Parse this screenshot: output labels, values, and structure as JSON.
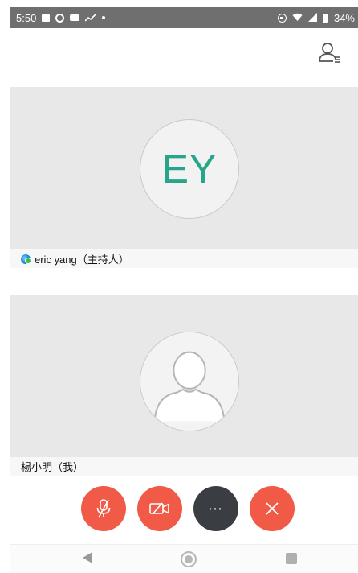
{
  "status_bar": {
    "time": "5:50",
    "battery": "34%",
    "left_icons": [
      "image-icon",
      "app-icon",
      "youtube-icon",
      "graph-icon",
      "dot-icon"
    ],
    "right_icons": [
      "dnd-icon",
      "wifi-icon",
      "signal-icon",
      "battery-icon"
    ]
  },
  "header": {
    "participants_icon": "participants-icon"
  },
  "participants": [
    {
      "initials": "EY",
      "name": "eric yang（主持人）",
      "is_host": true
    },
    {
      "initials": "",
      "name": "楊小明（我）",
      "is_host": false
    }
  ],
  "controls": {
    "mute": "mic-off-icon",
    "video": "video-off-icon",
    "more": "⋯",
    "leave": "close-icon"
  },
  "colors": {
    "accent_red": "#f05a46",
    "dark_button": "#3a3d42",
    "initials_green": "#27a58a"
  }
}
